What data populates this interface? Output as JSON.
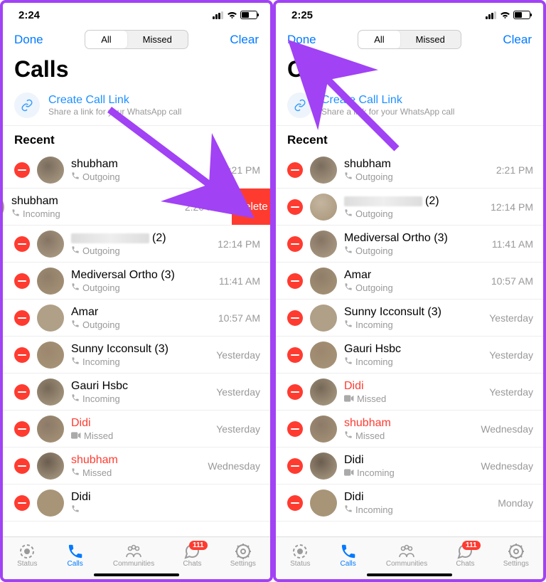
{
  "screens": [
    {
      "time": "2:24",
      "nav": {
        "left": "Done",
        "right": "Clear",
        "seg_all": "All",
        "seg_missed": "Missed"
      },
      "title": "Calls",
      "call_link": {
        "title": "Create Call Link",
        "sub": "Share a link for your WhatsApp call"
      },
      "section": "Recent",
      "rows": [
        {
          "name": "shubham",
          "sub": "Outgoing",
          "icon": "phone",
          "time": "2:21 PM",
          "missed": false,
          "blurred": false
        },
        {
          "name": "shubham",
          "sub": "Incoming",
          "icon": "phone",
          "time": "2:20 PM",
          "missed": false,
          "blurred": false,
          "swiped": true,
          "delete_label": "Delete"
        },
        {
          "name_blur": true,
          "count": "(2)",
          "sub": "Outgoing",
          "icon": "phone",
          "time": "12:14 PM",
          "missed": false
        },
        {
          "name": "Mediversal Ortho (3)",
          "sub": "Outgoing",
          "icon": "phone",
          "time": "11:41 AM",
          "missed": false
        },
        {
          "name": "Amar",
          "sub": "Outgoing",
          "icon": "phone",
          "time": "10:57 AM",
          "missed": false
        },
        {
          "name": "Sunny Icconsult (3)",
          "sub": "Incoming",
          "icon": "phone",
          "time": "Yesterday",
          "missed": false
        },
        {
          "name": "Gauri Hsbc",
          "sub": "Incoming",
          "icon": "phone",
          "time": "Yesterday",
          "missed": false
        },
        {
          "name": "Didi",
          "sub": "Missed",
          "icon": "video",
          "time": "Yesterday",
          "missed": true
        },
        {
          "name": "shubham",
          "sub": "Missed",
          "icon": "phone",
          "time": "Wednesday",
          "missed": true
        },
        {
          "name": "Didi",
          "sub": "",
          "icon": "phone",
          "time": "",
          "missed": false,
          "partial": true
        }
      ],
      "tabs": {
        "status": "Status",
        "calls": "Calls",
        "communities": "Communities",
        "chats": "Chats",
        "settings": "Settings",
        "badge": "111"
      },
      "arrow_target": "delete"
    },
    {
      "time": "2:25",
      "nav": {
        "left": "Done",
        "right": "Clear",
        "seg_all": "All",
        "seg_missed": "Missed"
      },
      "title": "Calls",
      "call_link": {
        "title": "Create Call Link",
        "sub": "Share a link for your WhatsApp call"
      },
      "section": "Recent",
      "rows": [
        {
          "name": "shubham",
          "sub": "Outgoing",
          "icon": "phone",
          "time": "2:21 PM",
          "missed": false
        },
        {
          "name_blur": true,
          "count": "(2)",
          "sub": "Outgoing",
          "icon": "phone",
          "time": "12:14 PM",
          "missed": false
        },
        {
          "name": "Mediversal Ortho (3)",
          "sub": "Outgoing",
          "icon": "phone",
          "time": "11:41 AM",
          "missed": false
        },
        {
          "name": "Amar",
          "sub": "Outgoing",
          "icon": "phone",
          "time": "10:57 AM",
          "missed": false
        },
        {
          "name": "Sunny Icconsult (3)",
          "sub": "Incoming",
          "icon": "phone",
          "time": "Yesterday",
          "missed": false
        },
        {
          "name": "Gauri Hsbc",
          "sub": "Incoming",
          "icon": "phone",
          "time": "Yesterday",
          "missed": false
        },
        {
          "name": "Didi",
          "sub": "Missed",
          "icon": "video",
          "time": "Yesterday",
          "missed": true
        },
        {
          "name": "shubham",
          "sub": "Missed",
          "icon": "phone",
          "time": "Wednesday",
          "missed": true
        },
        {
          "name": "Didi",
          "sub": "Incoming",
          "icon": "video",
          "time": "Wednesday",
          "missed": false
        },
        {
          "name": "Didi",
          "sub": "Incoming",
          "icon": "phone",
          "time": "Monday",
          "missed": false,
          "partial": true
        }
      ],
      "tabs": {
        "status": "Status",
        "calls": "Calls",
        "communities": "Communities",
        "chats": "Chats",
        "settings": "Settings",
        "badge": "111"
      },
      "arrow_target": "done"
    }
  ]
}
